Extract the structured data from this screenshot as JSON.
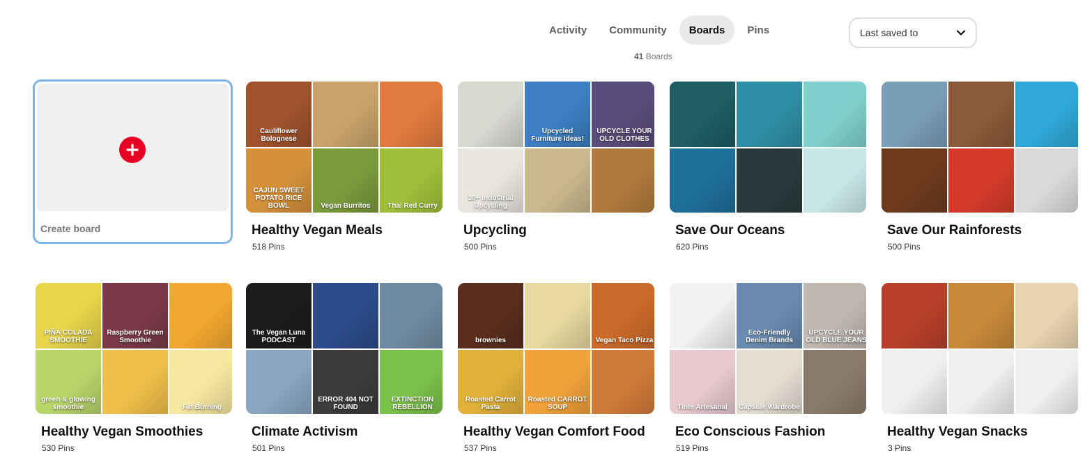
{
  "tabs": [
    {
      "label": "Activity",
      "active": false
    },
    {
      "label": "Community",
      "active": false
    },
    {
      "label": "Boards",
      "active": true
    },
    {
      "label": "Pins",
      "active": false
    }
  ],
  "boards_count": {
    "number": "41",
    "label": "Boards"
  },
  "sort": {
    "value": "Last saved to"
  },
  "create_board": {
    "label": "Create board"
  },
  "boards": [
    {
      "name": "Healthy Vegan Meals",
      "pins": "518 Pins",
      "tiles": [
        [
          "#a0522d",
          "Cauliflower Bolognese"
        ],
        [
          "#c9a46a",
          ""
        ],
        [
          "#e07a3e",
          ""
        ],
        [
          "#d4913a",
          "CAJUN SWEET POTATO RICE BOWL"
        ],
        [
          "#7a9b3c",
          "Vegan Burritos"
        ],
        [
          "#9fbf3a",
          "Thai Red Curry"
        ]
      ]
    },
    {
      "name": "Upcycling",
      "pins": "500 Pins",
      "tiles": [
        [
          "#d9d9d2",
          ""
        ],
        [
          "#3d7fc2",
          "Upcycled Furniture Ideas!"
        ],
        [
          "#5a4c7a",
          "UPCYCLE YOUR OLD CLOTHES"
        ],
        [
          "#e9e6df",
          "30+ Industrial Upcycling"
        ],
        [
          "#cbb98f",
          ""
        ],
        [
          "#b07a3c",
          ""
        ]
      ]
    },
    {
      "name": "Save Our Oceans",
      "pins": "620 Pins",
      "tiles": [
        [
          "#1d5d63",
          ""
        ],
        [
          "#2f8fa6",
          ""
        ],
        [
          "#7fd0cc",
          ""
        ],
        [
          "#1e6f9a",
          ""
        ],
        [
          "#2a3a3c",
          ""
        ],
        [
          "#c8e6e8",
          ""
        ]
      ]
    },
    {
      "name": "Save Our Rainforests",
      "pins": "500 Pins",
      "tiles": [
        [
          "#7a9db8",
          ""
        ],
        [
          "#8b5a3a",
          ""
        ],
        [
          "#2fa8d8",
          ""
        ],
        [
          "#6e3a1e",
          ""
        ],
        [
          "#d63b2a",
          ""
        ],
        [
          "#d9d9d9",
          ""
        ]
      ]
    },
    {
      "name": "Healthy Vegan Smoothies",
      "pins": "530 Pins",
      "tiles": [
        [
          "#e8d54a",
          "PIÑA COLADA SMOOTHIE"
        ],
        [
          "#7b3a4a",
          "Raspberry Green Smoothie"
        ],
        [
          "#f2a830",
          ""
        ],
        [
          "#b9d66b",
          "green & glowing smoothie"
        ],
        [
          "#f0c04a",
          ""
        ],
        [
          "#f5e6a0",
          "Fat Burning"
        ]
      ]
    },
    {
      "name": "Climate Activism",
      "pins": "501 Pins",
      "tiles": [
        [
          "#1c1c1c",
          "The Vegan Luna PODCAST"
        ],
        [
          "#2c4c8a",
          ""
        ],
        [
          "#6f8aa0",
          ""
        ],
        [
          "#8aa6c2",
          ""
        ],
        [
          "#3c3c3c",
          "ERROR 404 NOT FOUND"
        ],
        [
          "#7bc24a",
          "EXTINCTION REBELLION"
        ]
      ]
    },
    {
      "name": "Healthy Vegan Comfort Food",
      "pins": "537 Pins",
      "tiles": [
        [
          "#5a2e1e",
          "brownies"
        ],
        [
          "#e8d9a0",
          ""
        ],
        [
          "#c96a2a",
          "Vegan Taco Pizza"
        ],
        [
          "#e2b13a",
          "Roasted Carrot Pasta"
        ],
        [
          "#f2a23a",
          "Roasted CARROT SOUP"
        ],
        [
          "#d07b3a",
          ""
        ]
      ]
    },
    {
      "name": "Eco Conscious Fashion",
      "pins": "519 Pins",
      "tiles": [
        [
          "#f2f2f2",
          ""
        ],
        [
          "#6a8ab0",
          "Eco-Friendly Denim Brands"
        ],
        [
          "#c0b8b0",
          "UPCYCLE YOUR OLD BLUE JEANS"
        ],
        [
          "#e8c9d0",
          "Tinte Artesanal"
        ],
        [
          "#e4ddd2",
          "Capsule Wardrobe"
        ],
        [
          "#8a7a6a",
          ""
        ]
      ]
    },
    {
      "name": "Healthy Vegan Snacks",
      "pins": "3 Pins",
      "tiles": [
        [
          "#b8402a",
          ""
        ],
        [
          "#c88a3a",
          ""
        ],
        [
          "#e8d4b0",
          ""
        ],
        [
          "#efefef",
          ""
        ],
        [
          "#efefef",
          ""
        ],
        [
          "#efefef",
          ""
        ]
      ]
    }
  ]
}
